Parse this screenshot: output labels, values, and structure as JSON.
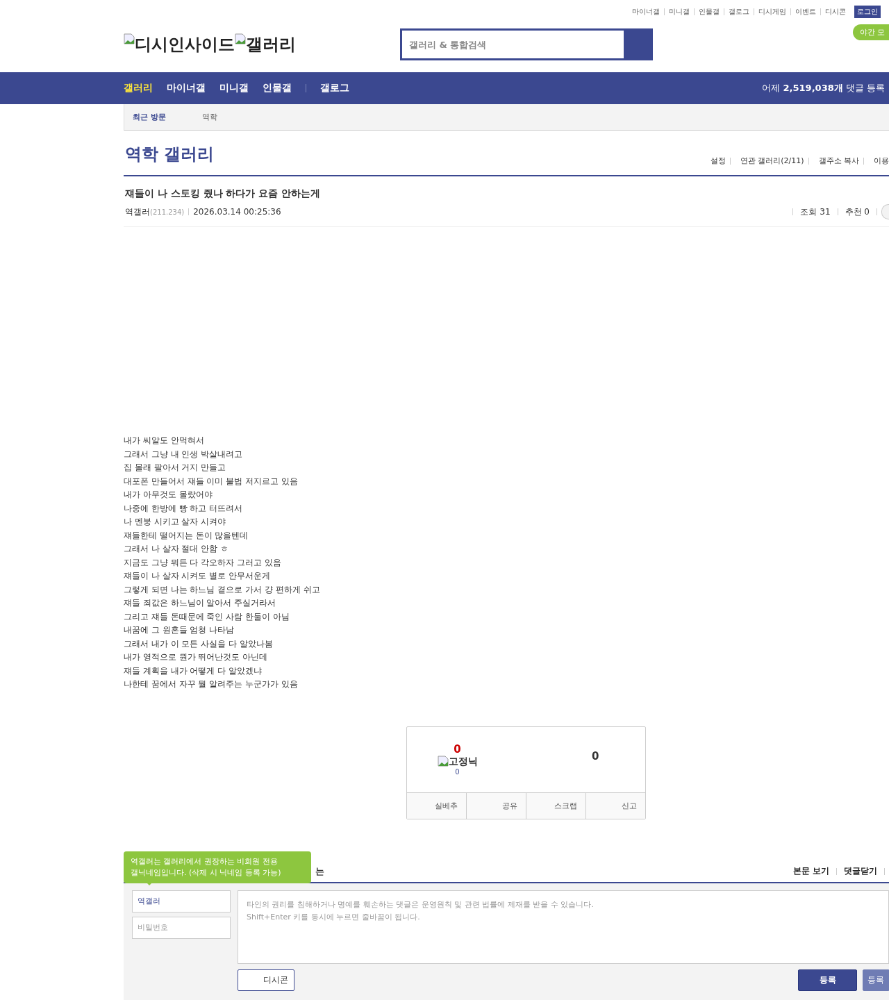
{
  "top_links": [
    "마이너갤",
    "미니갤",
    "인물갤",
    "갤로그",
    "디시게임",
    "이벤트",
    "디시콘"
  ],
  "login_button": "로그인",
  "night_mode_button": "야간 모",
  "logo": {
    "parts": [
      "디시인사이드",
      "갤러리"
    ]
  },
  "search": {
    "placeholder": "갤러리 & 통합검색"
  },
  "nav": {
    "items": [
      {
        "label": "갤러리",
        "selected": true
      },
      {
        "label": "마이너갤",
        "selected": false
      },
      {
        "label": "미니갤",
        "selected": false
      },
      {
        "label": "인물갤",
        "selected": false
      },
      {
        "label": "갤로그",
        "selected": false
      }
    ],
    "stat": "어제 **2,519,038개** 댓글 등록"
  },
  "recent": {
    "label": "최근 방문",
    "items": [
      "역학"
    ]
  },
  "gallery": {
    "title": "역학 갤러리",
    "links": [
      "설정",
      "연관 갤러리(2/11)",
      "갤주소 복사",
      "이용"
    ]
  },
  "post": {
    "title": "쟤들이 나 스토킹 줬나 하다가 요즘 안하는게",
    "author": "역갤러",
    "ip": "(211.234)",
    "date": "2026.03.14 00:25:36",
    "views": "조회 31",
    "recommends": "추천 0",
    "body": [
      "내가 씨알도 안먹혀서",
      "그래서 그냥 내 인생 박살내려고",
      "집 몰래 팔아서 거지 만들고",
      "대포폰 만들어서 쟤들 이미 불법 저지르고 있음",
      "내가 아무것도 몰랐어야",
      "나중에 한방에 빵 하고 터뜨려서",
      "나 멘붕 시키고 살자 시켜야",
      "쟤들한테 떨어지는 돈이 많을텐데",
      "그래서 나 살자 절대 안함 ㅎ",
      "지금도 그냥 뭐든 다 각오하자 그러고 있음",
      "쟤들이 나 살자 시켜도 별로 안무서운게",
      "그렇게 되면 나는 하느님 곁으로 가서 걍 편하게 쉬고",
      "쟤들 죄값은 하느님이 알아서 주실거라서",
      "그리고 쟤들 돈때문에 죽인 사람 한둘이 아님",
      "내꿈에 그 원혼들 엄청 나타남",
      "그래서 내가 이 모든 사실을 다 알았나봄",
      "내가 영적으로 뭔가 뛰어난것도 아닌데",
      "쟤들 계획을 내가 어떻게 다 알았겠냐",
      "나한테 꿈에서 자꾸 뭘 알려주는 누군가가 있음"
    ]
  },
  "vote": {
    "up_count": "0",
    "fixed_nick_label": "고정닉",
    "fixed_nick_count": "0",
    "down_count": "0",
    "buttons": [
      "실베추",
      "공유",
      "스크랩",
      "신고"
    ]
  },
  "comments": {
    "header_fragment": "는",
    "links": [
      "본문 보기",
      "댓글닫기"
    ],
    "tooltip": "역갤러는 갤러리에서 권장하는 비회원 전용\n갤닉네임입니다. (삭제 시 닉네임 등록 가능)",
    "name_value": "역갤러",
    "password_placeholder": "비밀번호",
    "textarea_placeholder": "타인의 권리를 침해하거나 명예를 훼손하는 댓글은 운영원칙 및 관련 법률에 제재를 받을 수 있습니다.\nShift+Enter 키를 동시에 누르면 줄바꿈이 됩니다.",
    "dccon_button": "디시콘",
    "submit_button": "등록",
    "submit_alt_button": "등록"
  }
}
